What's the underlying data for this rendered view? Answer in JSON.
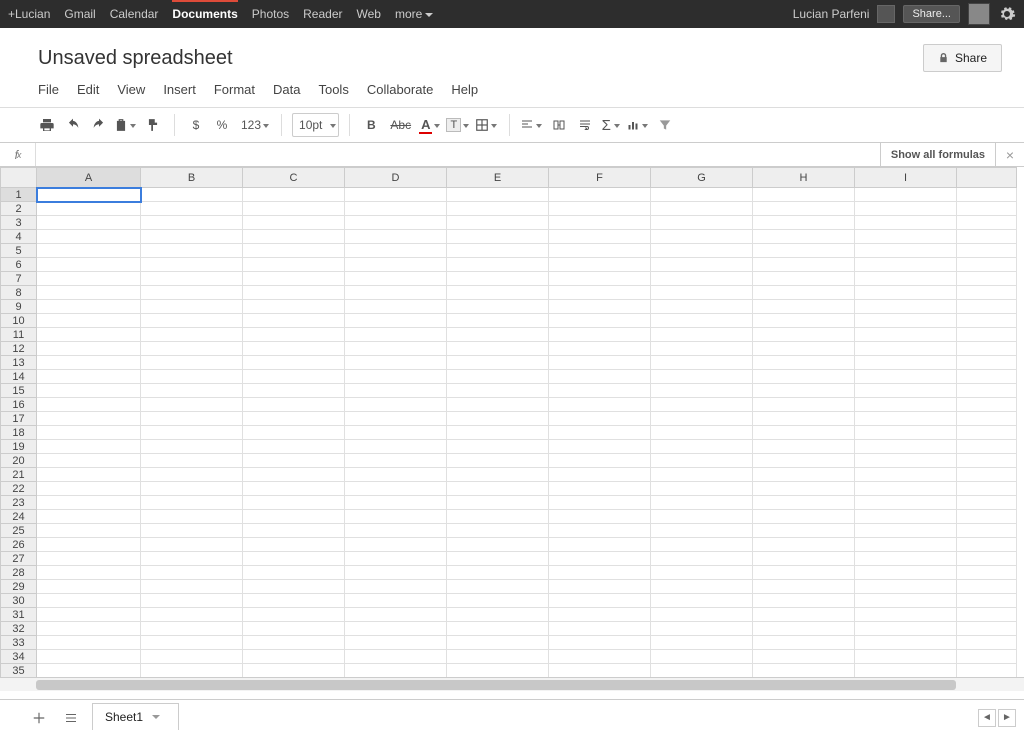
{
  "topbar": {
    "items": [
      "+Lucian",
      "Gmail",
      "Calendar",
      "Documents",
      "Photos",
      "Reader",
      "Web",
      "more"
    ],
    "active_index": 3,
    "username": "Lucian Parfeni",
    "share_label": "Share..."
  },
  "document": {
    "title": "Unsaved spreadsheet",
    "share_button": "Share"
  },
  "menus": [
    "File",
    "Edit",
    "View",
    "Insert",
    "Format",
    "Data",
    "Tools",
    "Collaborate",
    "Help"
  ],
  "toolbar": {
    "currency": "$",
    "percent": "%",
    "number_format": "123",
    "font_size": "10pt",
    "bold": "B",
    "strike": "Abc",
    "text_color": "A",
    "fill_letter": "T"
  },
  "formula_bar": {
    "label": "fx",
    "value": "",
    "show_all": "Show all formulas"
  },
  "grid": {
    "columns": [
      "A",
      "B",
      "C",
      "D",
      "E",
      "F",
      "G",
      "H",
      "I",
      ""
    ],
    "row_count": 36,
    "selected": {
      "row": 1,
      "col": 0
    }
  },
  "tabs": {
    "sheet_label": "Sheet1"
  }
}
